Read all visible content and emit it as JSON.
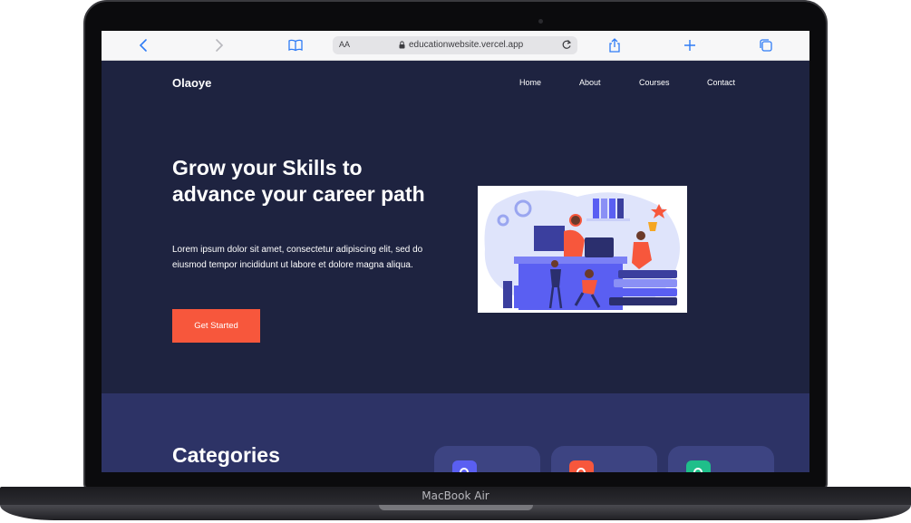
{
  "device": {
    "model_label": "MacBook Air"
  },
  "browser": {
    "text_size_label": "AA",
    "url": "educationwebsite.vercel.app",
    "icons": [
      "back-icon",
      "forward-icon",
      "bookmarks-icon",
      "lock-icon",
      "reload-icon",
      "share-icon",
      "new-tab-icon",
      "tabs-icon"
    ]
  },
  "site": {
    "logo": "Olaoye",
    "nav": [
      "Home",
      "About",
      "Courses",
      "Contact"
    ],
    "hero": {
      "title": "Grow your Skills to advance your career path",
      "body": "Lorem ipsum dolor sit amet, consectetur adipiscing elit, sed do eiusmod tempor incididunt ut labore et dolore magna aliqua.",
      "cta": "Get Started"
    },
    "categories": {
      "title": "Categories",
      "cards": [
        {
          "icon_color": "#5a5ff2"
        },
        {
          "icon_color": "#f7573c"
        },
        {
          "icon_color": "#1fbf8a"
        }
      ]
    }
  },
  "colors": {
    "background": "#1e2340",
    "categories_bg": "#2d3366",
    "accent": "#f7573c",
    "browser_link": "#2f7cf6"
  }
}
